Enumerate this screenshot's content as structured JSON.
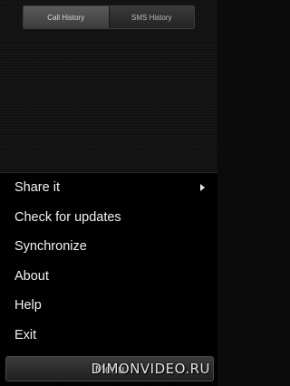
{
  "tabs": [
    {
      "label": "Call History"
    },
    {
      "label": "SMS History"
    }
  ],
  "menu": {
    "items": [
      {
        "label": "Share it"
      },
      {
        "label": "Check for updates"
      },
      {
        "label": "Synchronize"
      },
      {
        "label": "About"
      },
      {
        "label": "Help"
      },
      {
        "label": "Exit"
      }
    ]
  },
  "bottom_bar": {
    "label": "Menu"
  },
  "watermark": {
    "text": "DIMONVIDEO.RU"
  }
}
